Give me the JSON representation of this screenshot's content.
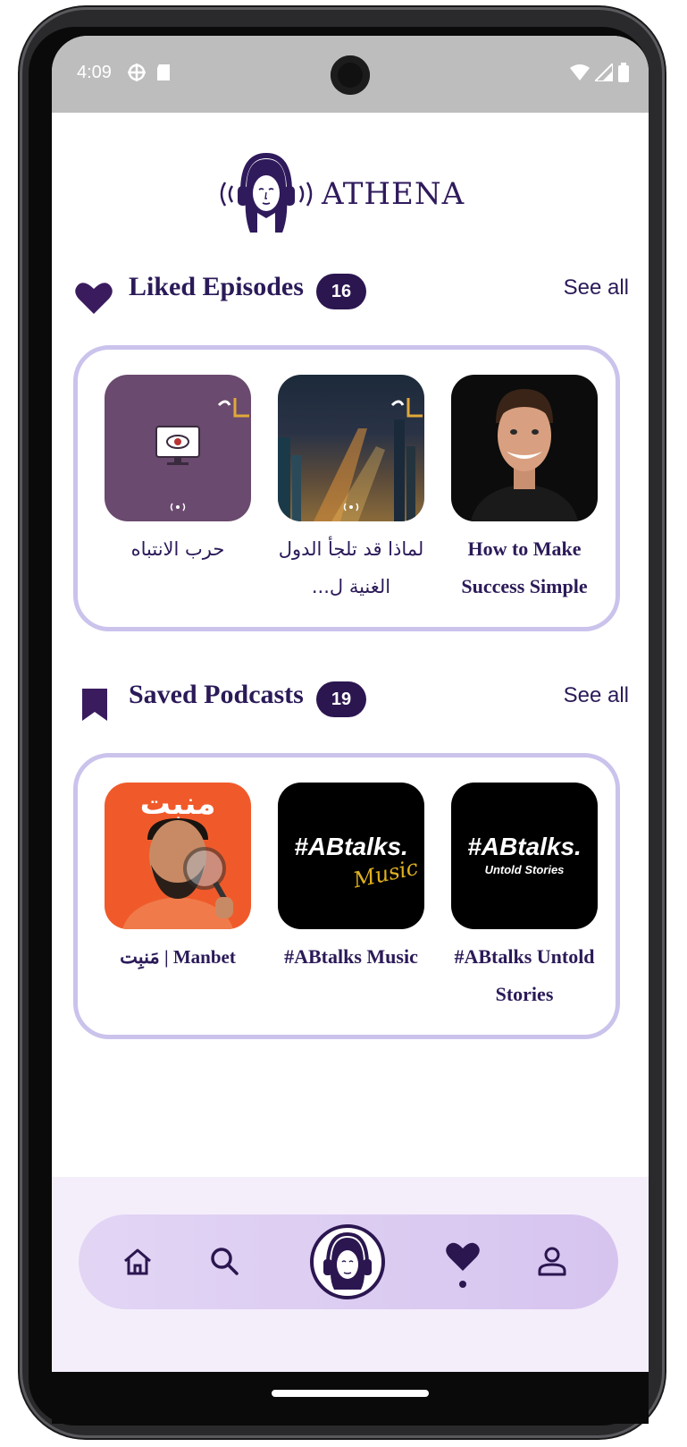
{
  "status_bar": {
    "time": "4:09"
  },
  "app": {
    "name": "ATHENA"
  },
  "liked": {
    "title": "Liked Episodes",
    "count": "16",
    "see_all": "See all",
    "items": [
      {
        "label": "حرب الانتباه",
        "arabic": true
      },
      {
        "label": "لماذا قد تلجأ الدول الغنية ل...",
        "arabic": true
      },
      {
        "label": "How to Make Success Simple",
        "arabic": false
      }
    ]
  },
  "saved": {
    "title": "Saved Podcasts",
    "count": "19",
    "see_all": "See all",
    "items": [
      {
        "label": "مَنبِت | Manbet"
      },
      {
        "label": "#ABtalks Music",
        "art_text": "#ABtalks.",
        "art_sub": "Music"
      },
      {
        "label": "#ABtalks Untold Stories",
        "art_text": "#ABtalks.",
        "art_sub": "Untold Stories"
      }
    ],
    "manbet_logo": "منبت"
  },
  "colors": {
    "accent": "#2b1650",
    "card_border": "#cbc3ec"
  },
  "nav": {
    "items": [
      "home-icon",
      "search-icon",
      "athena-logo-icon",
      "heart-icon",
      "profile-icon"
    ],
    "active": "heart-icon"
  }
}
